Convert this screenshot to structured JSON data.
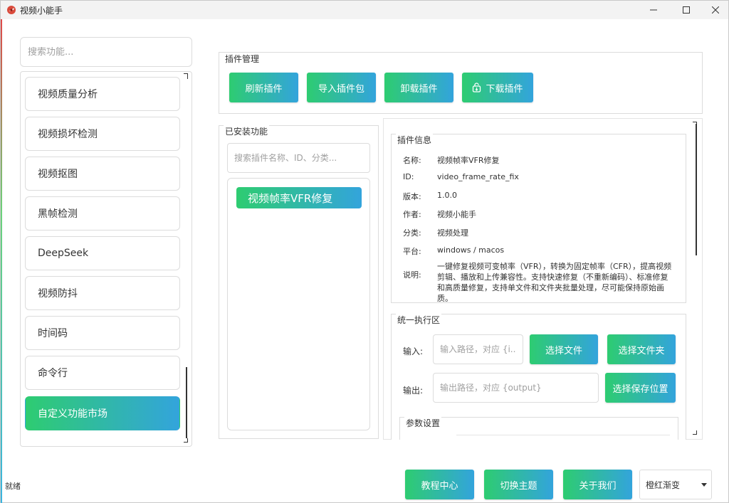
{
  "window": {
    "title": "视频小能手",
    "minimize": "—",
    "maximize": "☐",
    "close": "✕"
  },
  "sidebar": {
    "search_placeholder": "搜索功能...",
    "items": [
      {
        "label": "视频质量分析"
      },
      {
        "label": "视频损坏检测"
      },
      {
        "label": "视频抠图"
      },
      {
        "label": "黑帧检测"
      },
      {
        "label": "DeepSeek"
      },
      {
        "label": "视频防抖"
      },
      {
        "label": "时间码"
      },
      {
        "label": "命令行"
      },
      {
        "label": "自定义功能市场",
        "active": true
      }
    ]
  },
  "plugin_manage": {
    "title": "插件管理",
    "buttons": {
      "refresh": "刷新插件",
      "import": "导入插件包",
      "uninstall": "卸载插件",
      "download": "下载插件"
    }
  },
  "installed": {
    "title": "已安装功能",
    "search_placeholder": "搜索插件名称、ID、分类...",
    "items": [
      "视频帧率VFR修复"
    ]
  },
  "plugin_info": {
    "title": "插件信息",
    "rows": [
      {
        "label": "名称:",
        "value": "视频帧率VFR修复"
      },
      {
        "label": "ID:",
        "value": "video_frame_rate_fix"
      },
      {
        "label": "版本:",
        "value": "1.0.0"
      },
      {
        "label": "作者:",
        "value": "视频小能手"
      },
      {
        "label": "分类:",
        "value": "视频处理"
      },
      {
        "label": "平台:",
        "value": "windows / macos"
      }
    ],
    "desc_label": "说明:",
    "desc_value": "一键修复视频可变帧率（VFR），转换为固定帧率（CFR），提高视频剪辑、播放和上传兼容性。支持快速修复（不重新编码）、标准修复和高质量修复，支持单文件和文件夹批量处理，尽可能保持原始画质。"
  },
  "execution": {
    "title": "统一执行区",
    "input_label": "输入:",
    "input_placeholder": "输入路径，对应 {i...",
    "select_file": "选择文件",
    "select_folder": "选择文件夹",
    "output_label": "输出:",
    "output_placeholder": "输出路径，对应 {output}",
    "select_save": "选择保存位置",
    "params_title": "参数设置"
  },
  "bottom": {
    "status": "就绪",
    "tutorial": "教程中心",
    "switch_theme": "切换主题",
    "about": "关于我们",
    "theme_value": "橙红渐变"
  },
  "colors": {
    "accent_start": "#2ecc71",
    "accent_end": "#33a4dc"
  }
}
